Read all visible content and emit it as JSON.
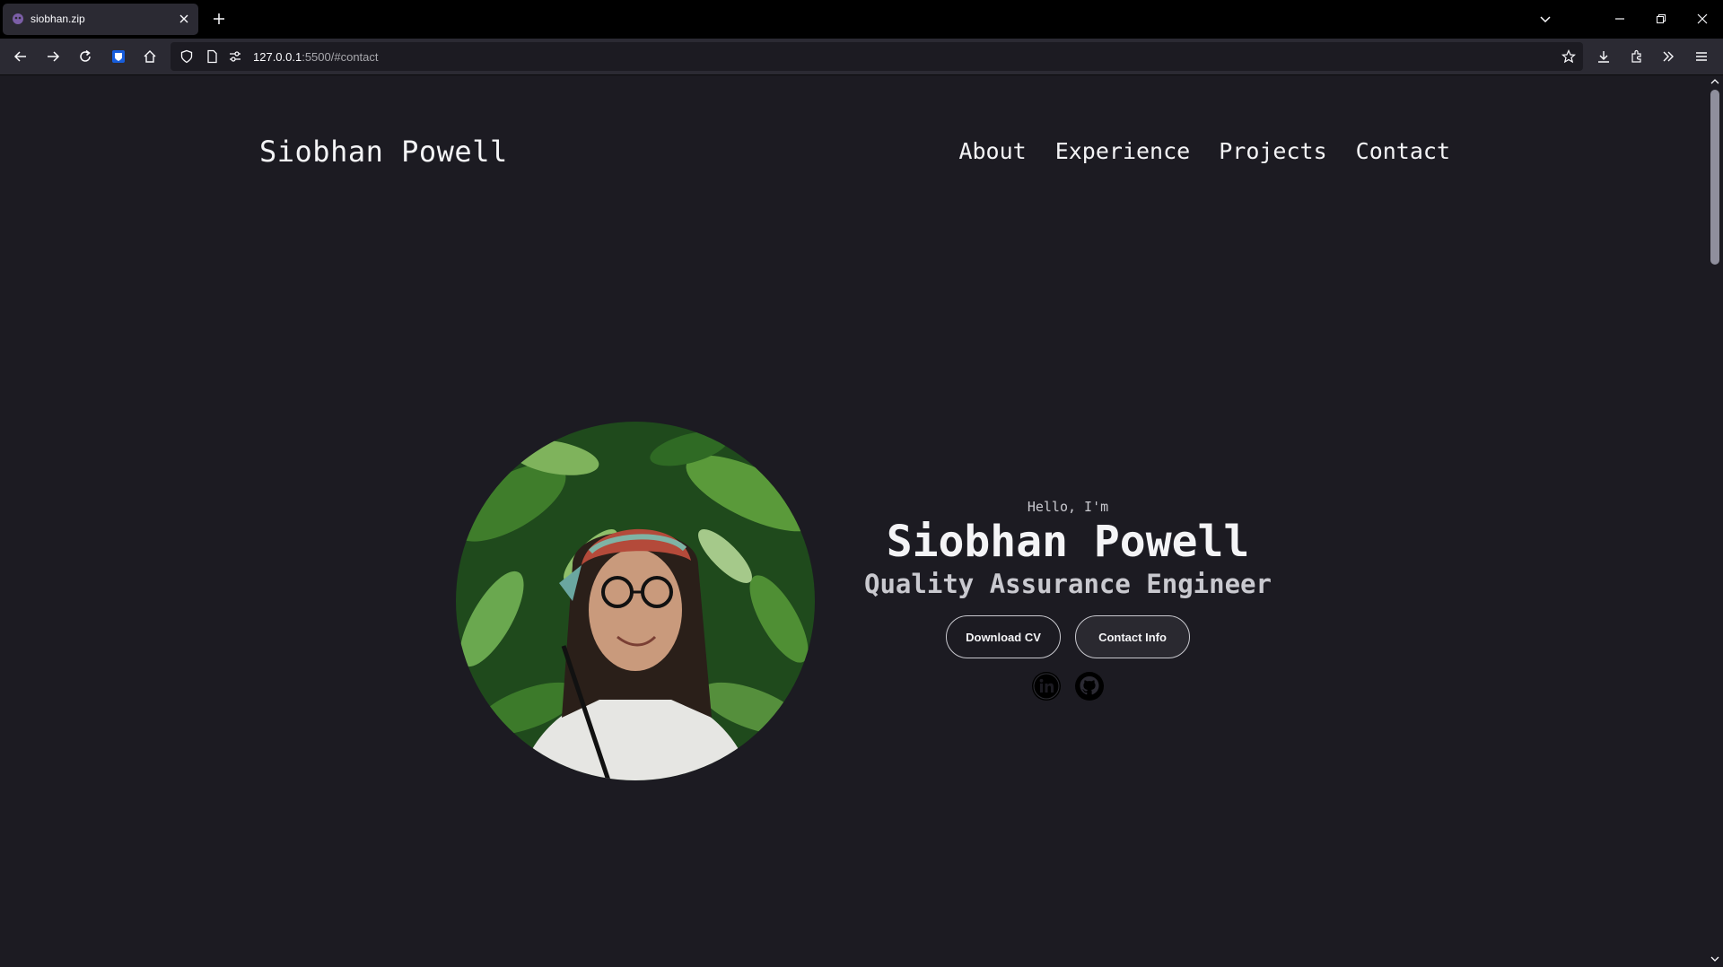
{
  "browser": {
    "tab_title": "siobhan.zip",
    "url_host": "127.0.0.1",
    "url_rest": ":5500/#contact"
  },
  "site": {
    "brand": "Siobhan Powell",
    "nav": [
      "About",
      "Experience",
      "Projects",
      "Contact"
    ]
  },
  "hero": {
    "greeting": "Hello, I'm",
    "name": "Siobhan Powell",
    "role": "Quality Assurance Engineer",
    "buttons": {
      "download_cv": "Download CV",
      "contact_info": "Contact Info"
    },
    "socials": [
      "linkedin-icon",
      "github-icon"
    ]
  },
  "colors": {
    "page_bg": "#1c1b22",
    "text": "#f4f4f6",
    "muted": "#c9c9cf"
  }
}
